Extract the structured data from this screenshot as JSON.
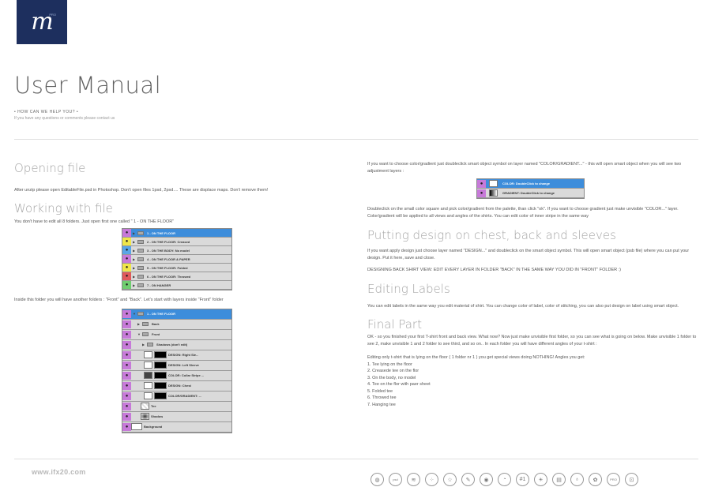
{
  "logo": {
    "glyph": "m",
    "superscript": "PRO"
  },
  "title": "User Manual",
  "help": {
    "heading": "• HOW CAN WE HELP YOU? •",
    "subtext": "If you have any questions or comments please contact us"
  },
  "left": {
    "opening_heading": "Opening file",
    "opening_text": "After unzip please open EditableFile.psd in Photoshop. Don't open files 1psd, 2psd.... These are displace maps. Don't remove them!",
    "working_heading": "Working with file",
    "working_text": "You don't have to edit all 8 folders. Just open first one called \" 1 - ON THE FLOOR\"",
    "folders": [
      "1 - ON THE FLOOR",
      "2 - ON THE FLOOR: Creased",
      "3 - ON THE BODY: No model",
      "4 - ON THE FLOOR & PAPER",
      "5 - ON THE FLOOR: Folded",
      "6 - ON THE FLOOR: Throwed",
      "7 - ON HANGER"
    ],
    "inside_text": "Inside this folder you will have another folders : \"Front\" and \"Back\". Let's start with layers inside \"Front\" folder",
    "layers": [
      "1 - ON THE FLOOR",
      "Back",
      "Front",
      "Shadows (don't edit)",
      "DESIGN: Right Sle...",
      "DESIGN: Left Sleeve",
      "COLOR: Collar Stripe ...",
      "DESIGN: Chest",
      "COLOR/GRADIENT: ...",
      "Tee",
      "Shadow",
      "Background"
    ]
  },
  "right": {
    "color_text": "If you want to choose color/gradient just doubleclick smart object symbol on layer named \"COLOR/GRADIENT...\" - this will open smart object when you will see two adjustment layers :",
    "adjust_layers": [
      "COLOR: DoubleClick to change",
      "GRADIENT: DoubleClick to change"
    ],
    "color_text2": "Doubleclick on the small color square and pick color/gradient from the palette, than click \"ok\". If you want to choose gradient just make unvisible \"COLOR...\" layer. Color/gradient will be applied to all views and angles of the shirts. You can edit color of inner stripe in the same way",
    "design_heading": "Putting design on chest, back and sleeves",
    "design_text": "If you want apply design just choose layer named \"DESIGN...\" and doubleclick on the smart object symbol. This will open smart object (psb file) where you can put your design. Put it here, save and close.",
    "design_text2": "DESIGNING BACK SHIRT VIEW: EDIT EVERY LAYER IN FOLDER \"BACK\" IN THE SAME WAY YOU DID IN \"FRONT\" FOLDER :)",
    "labels_heading": "Editing Labels",
    "labels_text": "You can edit labels in the same way you edit material of shirt. You can change color of label, color of stitching, you can also put design on label using smart object.",
    "final_heading": "Final Part",
    "final_text": "OK - so you finished your first T-shirt front and back view. What now? Now just make unvisible first folder, so you can see what is going on below. Make unvisible 1 folder to see 2, make unvisible 1 and 2 folder to see third, and so on.. In each folder you will have different angles of your t-shirt :",
    "final_text2": "Editing only t-shirt that is lying on the floor ( 1 folder nr 1 ) you get special views doing NOTHING! Angles you get:",
    "angles": [
      "1. Tee lying on the floor",
      "2. Creasede tee on the flor",
      "3. On the body, no model",
      "4. Tee on the flor with paer sheet",
      "5. Folded tee",
      "6. Throwed tee",
      "7. Hanging tee"
    ]
  },
  "footer": {
    "url": "www.ifx20.com",
    "icons": [
      "globe-icon",
      "psd-icon",
      "layers-icon",
      "dots-ring-icon",
      "star-icon",
      "brush-icon",
      "eye-icon",
      "timer-icon",
      "number-one-icon",
      "lamp-icon",
      "text-icon",
      "bulb-icon",
      "gear-icon",
      "pro-icon",
      "lock-icon"
    ],
    "icon_glyphs": [
      "◍",
      "psd",
      "≋",
      "⁘",
      "☆",
      "✎",
      "◉",
      "◔",
      "#1",
      "☀",
      "▤",
      "♁",
      "✿",
      "PRO",
      "⊡"
    ]
  },
  "colors": {
    "logo_bg": "#1d2f5e",
    "selected_layer": "#3d8ddb",
    "eye_purple": "#c77ad9"
  }
}
